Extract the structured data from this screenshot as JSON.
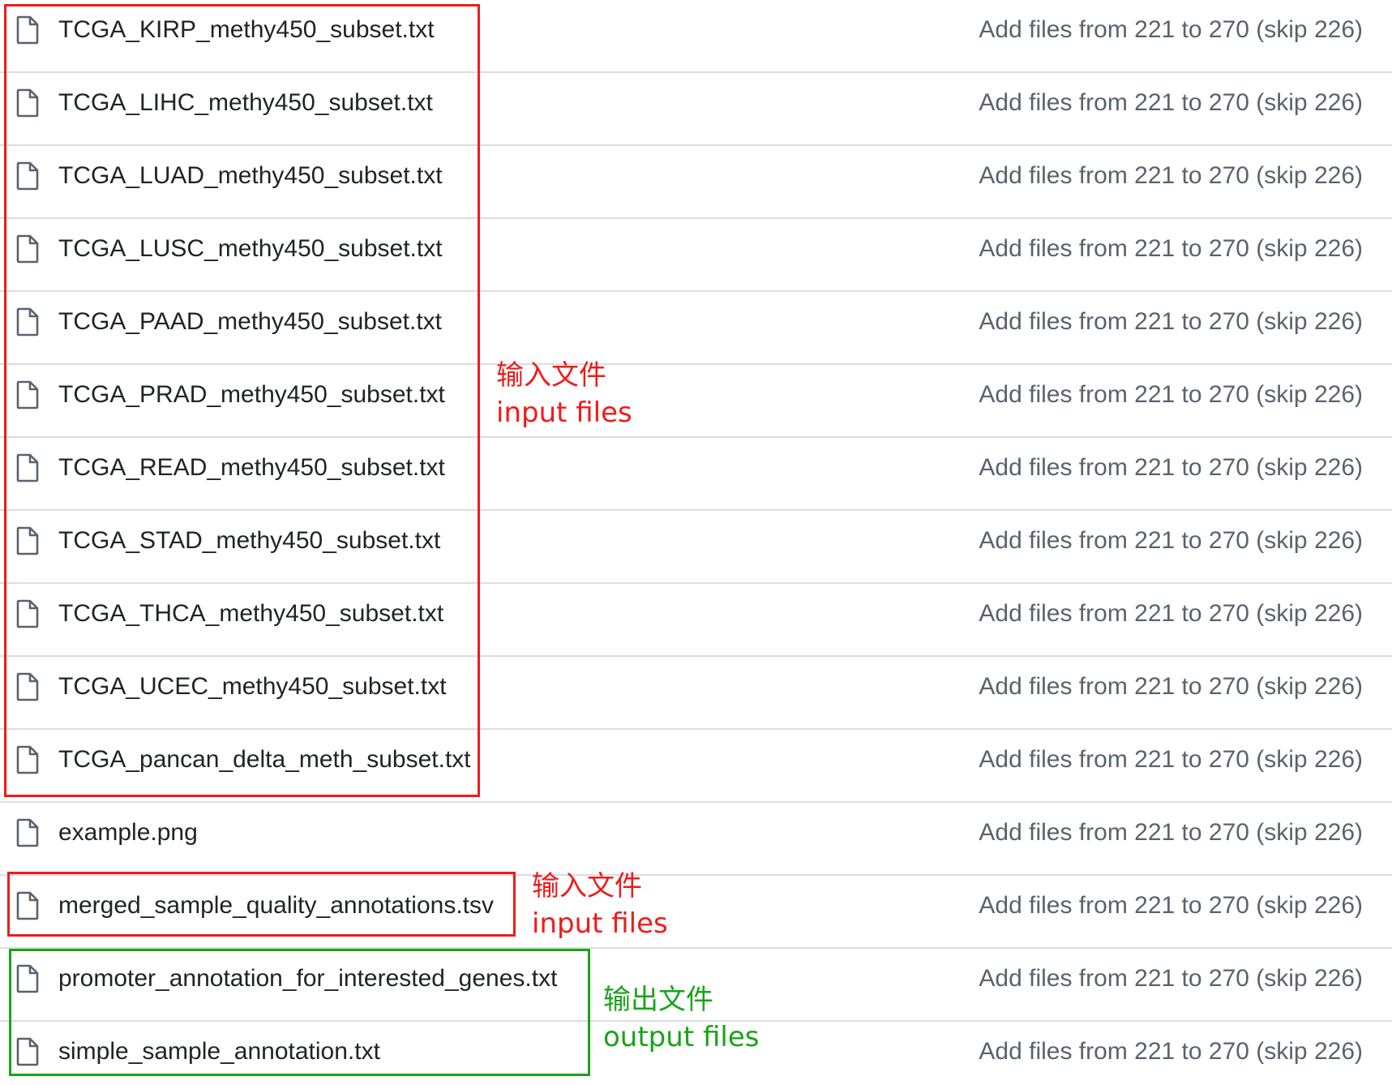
{
  "files": [
    {
      "name": "TCGA_KIRP_methy450_subset.txt",
      "icon": "file-icon",
      "message": "Add files from 221 to 270 (skip 226)"
    },
    {
      "name": "TCGA_LIHC_methy450_subset.txt",
      "icon": "file-icon",
      "message": "Add files from 221 to 270 (skip 226)"
    },
    {
      "name": "TCGA_LUAD_methy450_subset.txt",
      "icon": "file-icon",
      "message": "Add files from 221 to 270 (skip 226)"
    },
    {
      "name": "TCGA_LUSC_methy450_subset.txt",
      "icon": "file-icon",
      "message": "Add files from 221 to 270 (skip 226)"
    },
    {
      "name": "TCGA_PAAD_methy450_subset.txt",
      "icon": "file-icon",
      "message": "Add files from 221 to 270 (skip 226)"
    },
    {
      "name": "TCGA_PRAD_methy450_subset.txt",
      "icon": "file-icon",
      "message": "Add files from 221 to 270 (skip 226)"
    },
    {
      "name": "TCGA_READ_methy450_subset.txt",
      "icon": "file-icon",
      "message": "Add files from 221 to 270 (skip 226)"
    },
    {
      "name": "TCGA_STAD_methy450_subset.txt",
      "icon": "file-icon",
      "message": "Add files from 221 to 270 (skip 226)"
    },
    {
      "name": "TCGA_THCA_methy450_subset.txt",
      "icon": "file-icon",
      "message": "Add files from 221 to 270 (skip 226)"
    },
    {
      "name": "TCGA_UCEC_methy450_subset.txt",
      "icon": "file-icon",
      "message": "Add files from 221 to 270 (skip 226)"
    },
    {
      "name": "TCGA_pancan_delta_meth_subset.txt",
      "icon": "file-icon",
      "message": "Add files from 221 to 270 (skip 226)"
    },
    {
      "name": "example.png",
      "icon": "file-icon",
      "message": "Add files from 221 to 270 (skip 226)"
    },
    {
      "name": "merged_sample_quality_annotations.tsv",
      "icon": "file-icon",
      "message": "Add files from 221 to 270 (skip 226)"
    },
    {
      "name": "promoter_annotation_for_interested_genes.txt",
      "icon": "file-icon",
      "message": "Add files from 221 to 270 (skip 226)"
    },
    {
      "name": "simple_sample_annotation.txt",
      "icon": "file-icon",
      "message": "Add files from 221 to 270 (skip 226)"
    }
  ],
  "annotations": {
    "input_group": {
      "zh": "输入文件",
      "en": "input files",
      "color": "#ee1c1c"
    },
    "input_single": {
      "zh": "输入文件",
      "en": "input files",
      "color": "#ee1c1c"
    },
    "output_group": {
      "zh": "输出文件",
      "en": "output files",
      "color": "#1aa31a"
    }
  }
}
